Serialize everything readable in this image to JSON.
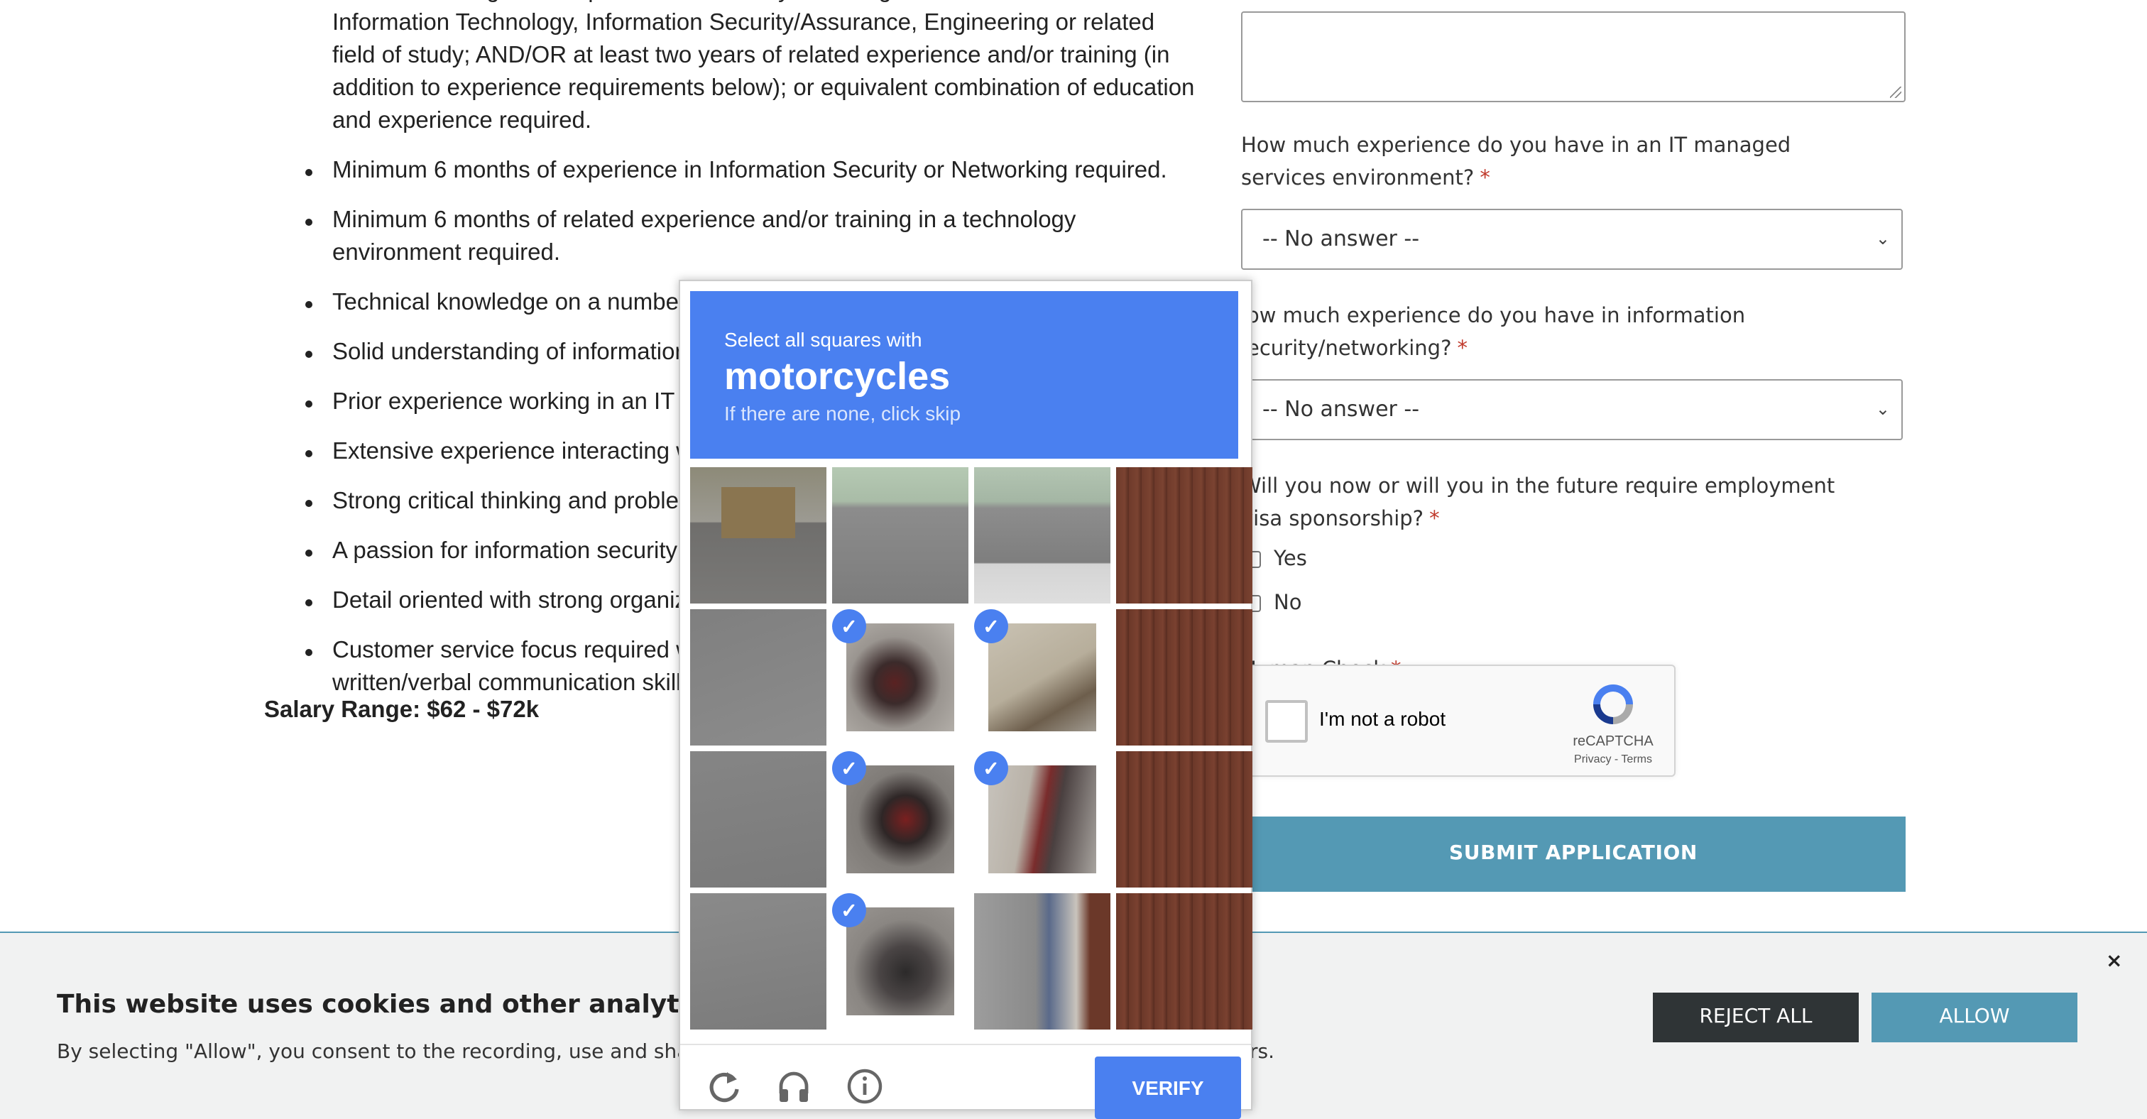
{
  "job": {
    "bullets": [
      "Associate's Degree or equivalent from two-year college or technical school in Information Technology, Information Security/Assurance, Engineering or related field of study; AND/OR at least two years of related experience and/or training (in addition to experience requirements below); or equivalent combination of education and experience required.",
      "Minimum 6 months of experience in Information Security or Networking required.",
      "Minimum 6 months of related experience and/or training in a technology environment required.",
      "Technical knowledge on a number o",
      "Solid understanding of information s",
      "Prior experience working in an IT m",
      "Extensive experience interacting wit",
      "Strong critical thinking and problem-",
      "A passion for information security ar",
      "Detail oriented with strong organiza",
      "Customer service focus required wit written/verbal communication skills."
    ],
    "salary": "Salary Range: $62 - $72k"
  },
  "form": {
    "q1": "How much experience do you have in an IT managed services environment?",
    "q1_value": "-- No answer --",
    "q2": "ow much experience do you have in information ecurity/networking?",
    "q2_value": "-- No answer --",
    "q3": "Will you now or will you in the future require employment visa sponsorship?",
    "q3_yes": "Yes",
    "q3_no": "No",
    "human_check": "Human Check",
    "required_mark": "*",
    "recaptcha_label": "I'm not a robot",
    "recaptcha_brand": "reCAPTCHA",
    "recaptcha_terms": "Privacy - Terms",
    "submit": "SUBMIT APPLICATION"
  },
  "captcha": {
    "instruction": "Select all squares with",
    "target": "motorcycles",
    "hint": "If there are none, click skip",
    "verify": "VERIFY",
    "selected_tiles": [
      5,
      6,
      9,
      10,
      13
    ],
    "icons": [
      "reload-icon",
      "headphones-icon",
      "info-icon"
    ]
  },
  "cookie": {
    "title": "This website uses cookies and other analytics techn",
    "body": "By selecting \"Allow\", you consent to the recording, use and sharing",
    "body_tail": "rs.",
    "reject": "REJECT ALL",
    "allow": "ALLOW",
    "close": "×"
  },
  "colors": {
    "accent": "#5499b4",
    "captcha_blue": "#4a80f0",
    "dark_button": "#2f3436"
  }
}
